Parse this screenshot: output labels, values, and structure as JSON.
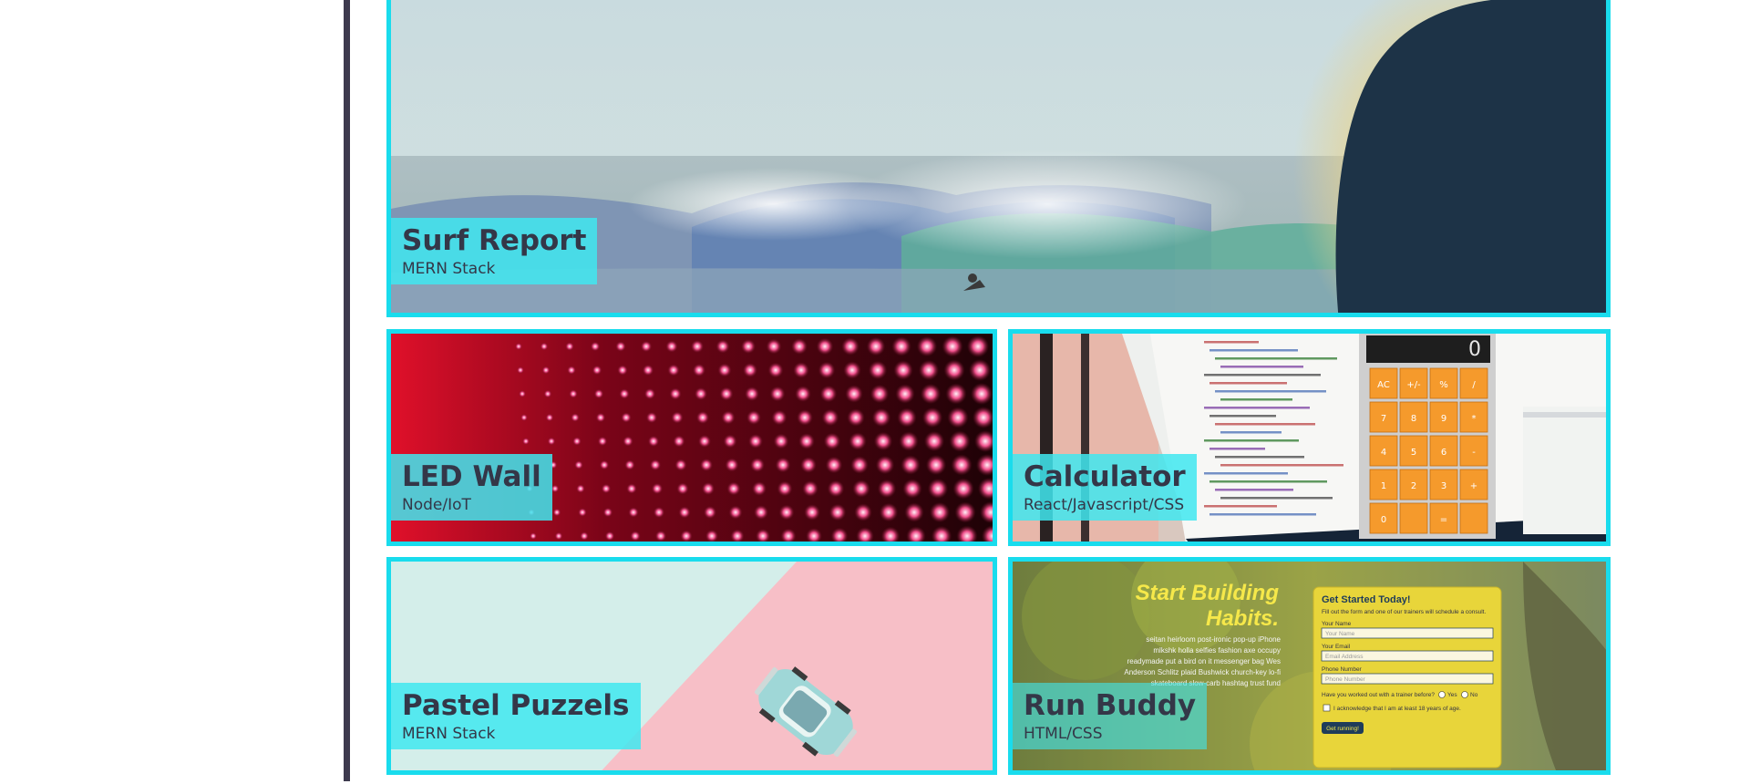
{
  "projects": [
    {
      "title": "Surf Report",
      "stack": "MERN Stack"
    },
    {
      "title": "LED Wall",
      "stack": "Node/IoT"
    },
    {
      "title": "Calculator",
      "stack": "React/Javascript/CSS"
    },
    {
      "title": "Pastel Puzzels",
      "stack": "MERN Stack"
    },
    {
      "title": "Run Buddy",
      "stack": "HTML/CSS"
    }
  ],
  "calculator_art": {
    "display": "0",
    "keys": [
      "AC",
      "+/-",
      "%",
      "/",
      "7",
      "8",
      "9",
      "*",
      "4",
      "5",
      "6",
      "-",
      "1",
      "2",
      "3",
      "+",
      "0",
      "",
      "=",
      ""
    ]
  },
  "run_buddy_art": {
    "headline_1": "Start Building",
    "headline_2": "Habits.",
    "body_text": "seitan heirloom post-ironic pop-up iPhone mlkshk holla selfies fashion axe occupy readymade put a bird on it messenger bag Wes Anderson Schlitz plaid Bushwick church-key lo-fi skateboard slow-carb hashtag trust fund",
    "form_title": "Get Started Today!",
    "form_subtitle": "Fill out the form and one of our trainers will schedule a consult.",
    "name_label": "Your Name",
    "name_placeholder": "Your Name",
    "email_label": "Your Email",
    "email_placeholder": "Email Address",
    "phone_label": "Phone Number",
    "phone_placeholder": "Phone Number",
    "question": "Have you worked out with a trainer before?",
    "yes": "Yes",
    "no": "No",
    "ack": "I acknowledge that I am at least 18 years of age.",
    "button": "Get running!"
  },
  "colors": {
    "card_border": "#19dced",
    "label_bg": "#40e8f0",
    "label_text": "#343748",
    "sidebar_rule": "#3d3a4e"
  }
}
